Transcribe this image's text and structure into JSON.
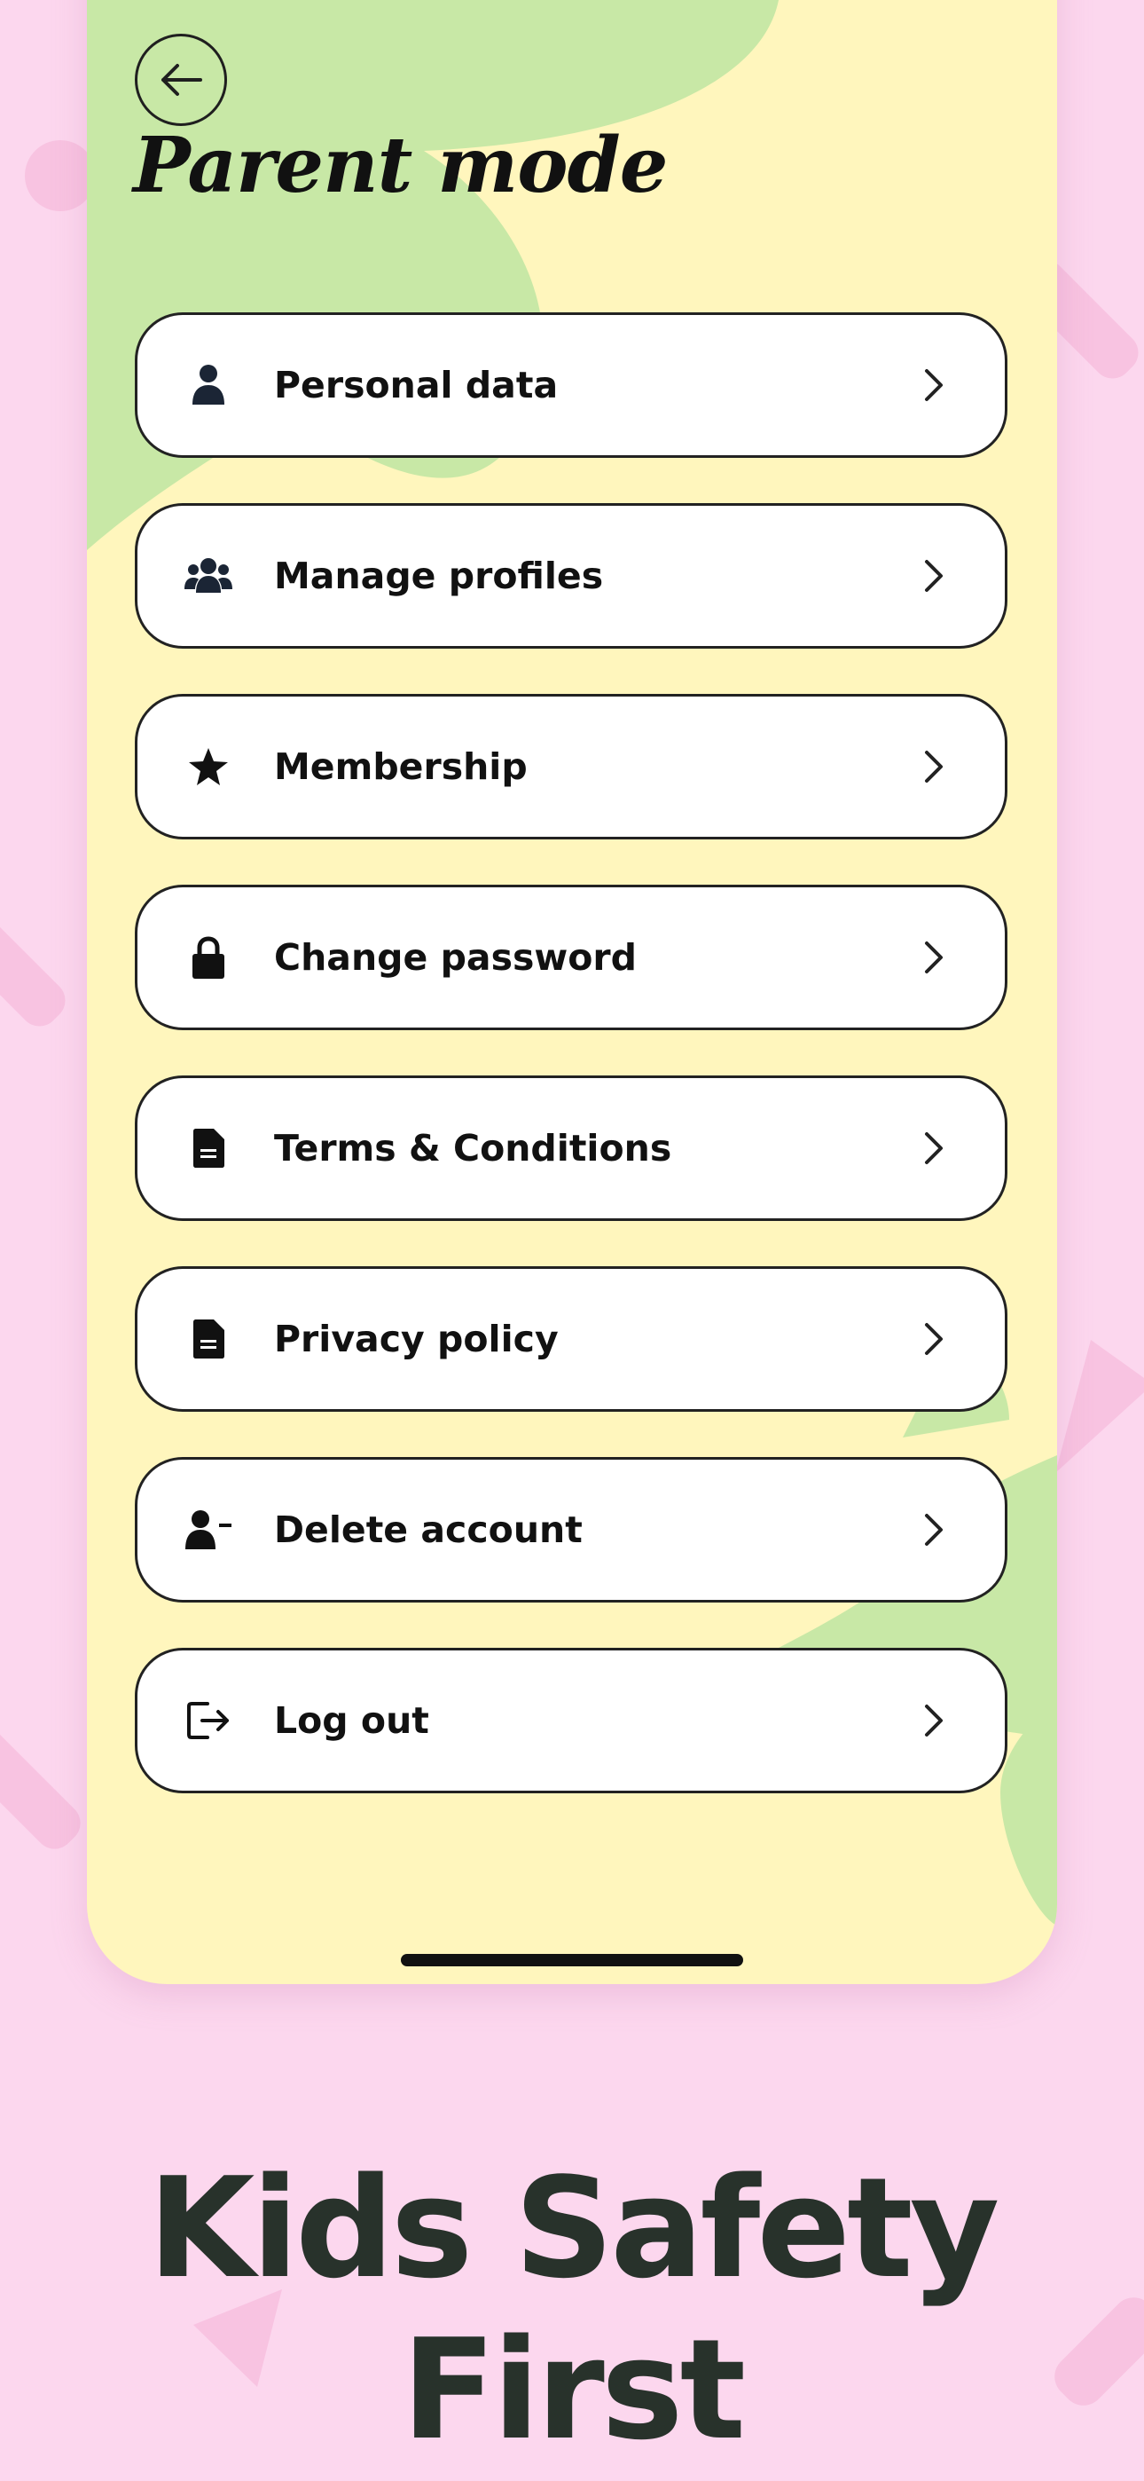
{
  "screen": {
    "title": "Parent mode",
    "back_icon": "arrow-left-icon"
  },
  "menu": [
    {
      "label": "Personal data",
      "icon": "person-icon"
    },
    {
      "label": "Manage profiles",
      "icon": "group-icon"
    },
    {
      "label": "Membership",
      "icon": "star-icon"
    },
    {
      "label": "Change password",
      "icon": "lock-icon"
    },
    {
      "label": "Terms & Conditions",
      "icon": "document-icon"
    },
    {
      "label": "Privacy policy",
      "icon": "document-icon"
    },
    {
      "label": "Delete account",
      "icon": "person-remove-icon"
    },
    {
      "label": "Log out",
      "icon": "logout-icon"
    }
  ],
  "marketing": {
    "tagline": "Kids Safety First"
  },
  "colors": {
    "background": "#fcd7ee",
    "screen": "#fff6bd",
    "accent_green": "#c8e8a6",
    "text": "#111111",
    "tagline": "#28322b"
  }
}
